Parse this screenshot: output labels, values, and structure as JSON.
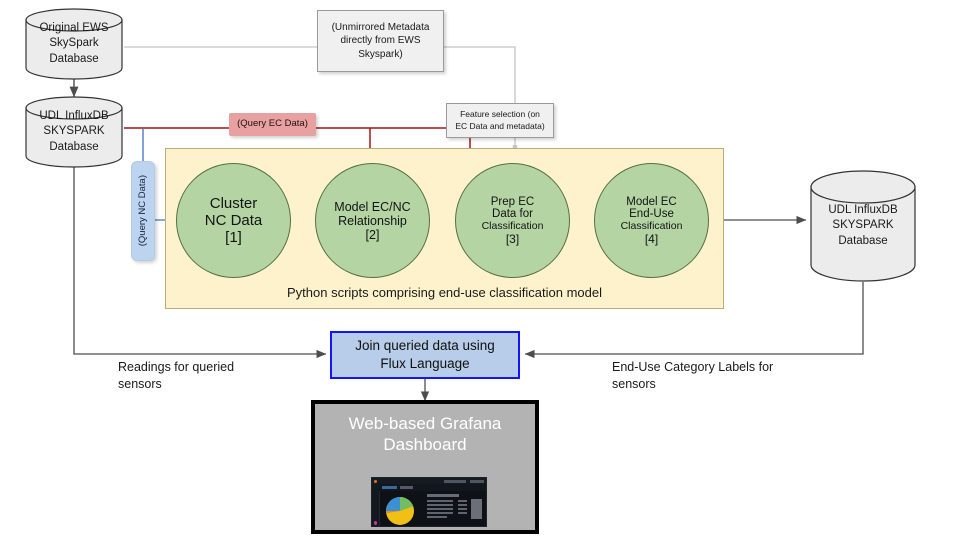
{
  "diagram": {
    "title": "End-use classification data pipeline",
    "background": "#ffffff",
    "colors": {
      "cylinder_fill": "#ececec",
      "cylinder_stroke": "#333333",
      "circle_fill": "#b4d4a4",
      "circle_stroke": "#56703f",
      "container_fill": "#fdf2cc",
      "container_stroke": "#b8ad7d",
      "red_label_fill": "#e8a0a0",
      "red_edge": "#a51414",
      "blue_label_fill": "#bcd4ef",
      "blue_edge": "#3b73c4",
      "flux_fill": "#b8cde9",
      "flux_stroke": "#1414ff",
      "gray_edge": "#bdbdbd",
      "dark_edge": "#4d4d4d",
      "grafana_fill": "#b3b3b3",
      "grafana_stroke": "#000000"
    }
  },
  "databases": {
    "original_ews": {
      "line1": "Original EWS",
      "line2": "SkySpark",
      "line3": "Database",
      "text": "Original EWS\nSkySpark\nDatabase"
    },
    "udl_influx_left": {
      "line1": "UDL InfluxDB",
      "line2": "SKYSPARK",
      "line3": "Database",
      "text": "UDL InfluxDB\nSKYSPARK\nDatabase"
    },
    "udl_influx_right": {
      "line1": "UDL InfluxDB",
      "line2": "SKYSPARK",
      "line3": "Database",
      "text": "UDL InfluxDB\nSKYSPARK\nDatabase"
    }
  },
  "annotations": {
    "unmirrored_metadata": "(Unmirrored Metadata\ndirectly from EWS\nSkyspark)",
    "feature_selection": "Feature selection (on\nEC Data and metadata)",
    "query_ec_data": "(Query EC Data)",
    "query_nc_data": "(Query NC Data)",
    "readings_for_queried_sensors": "Readings for queried\nsensors",
    "end_use_category_labels": "End-Use Category Labels for\nsensors"
  },
  "model_container": {
    "caption": "Python scripts comprising end-use classification model",
    "steps": [
      {
        "index": "[1]",
        "line1": "Cluster",
        "line2": "NC Data",
        "line3": "",
        "text": "Cluster\nNC Data"
      },
      {
        "index": "[2]",
        "line1": "Model EC/NC",
        "line2": "Relationship",
        "line3": "",
        "text": "Model EC/NC\nRelationship"
      },
      {
        "index": "[3]",
        "line1": "Prep EC",
        "line2": "Data for",
        "line3": "Classification",
        "text": "Prep EC\nData for\nClassification"
      },
      {
        "index": "[4]",
        "line1": "Model EC",
        "line2": "End-Use",
        "line3": "Classification",
        "text": "Model EC\nEnd-Use\nClassification"
      }
    ]
  },
  "flux_node": {
    "line1": "Join queried data using",
    "line2": "Flux Language",
    "text": "Join queried data using\nFlux Language"
  },
  "grafana": {
    "line1": "Web-based Grafana",
    "line2": "Dashboard",
    "text": "Web-based Grafana\nDashboard",
    "screenshot": {
      "kind": "grafana-dashboard-thumbnail",
      "pie_slices": [
        {
          "label": "blue",
          "color": "#3b8fd4",
          "percent": 23
        },
        {
          "label": "green",
          "color": "#72bd61",
          "percent": 18
        },
        {
          "label": "yellow",
          "color": "#f2c015",
          "percent": 53
        },
        {
          "label": "orange",
          "color": "#e08a2e",
          "percent": 6
        }
      ]
    }
  }
}
